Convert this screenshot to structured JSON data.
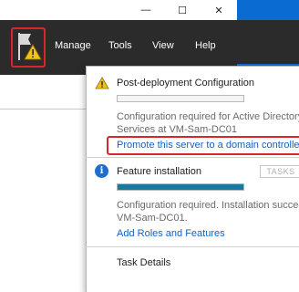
{
  "window": {
    "minimize_glyph": "—",
    "maximize_glyph": "☐",
    "close_glyph": "✕"
  },
  "menu": {
    "items": [
      "Manage",
      "Tools",
      "View",
      "Help"
    ]
  },
  "notifications": [
    {
      "icon": "warning-icon",
      "title": "Post-deployment Configuration",
      "progress": 0,
      "message_lines": [
        "Configuration required for Active Directory",
        "Services at VM-Sam-DC01"
      ],
      "link": "Promote this server to a domain controller"
    },
    {
      "icon": "info-icon",
      "title": "Feature installation",
      "tasks_label": "TASKS",
      "progress": 1.0,
      "message_lines": [
        "Configuration required. Installation succeed",
        "VM-Sam-DC01."
      ],
      "link": "Add Roles and Features"
    }
  ],
  "task_details": "Task Details",
  "colors": {
    "menubar": "#2b2b2b",
    "accent_blue": "#0a6cd0",
    "link": "#1660c2",
    "highlight_red": "#d8262c",
    "progress_fill": "#1b7a9c"
  }
}
